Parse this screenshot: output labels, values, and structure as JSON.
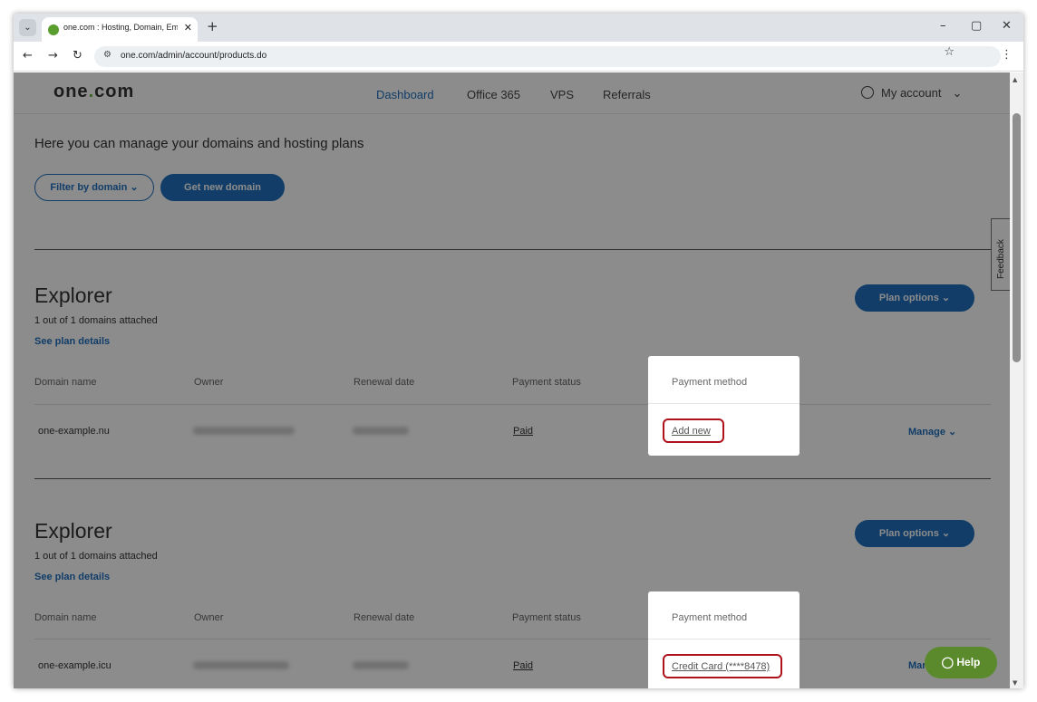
{
  "browser": {
    "tab_title": "one.com : Hosting, Domain, Email",
    "url": "one.com/admin/account/products.do",
    "new_tab": "+",
    "close_tab": "✕"
  },
  "header": {
    "logo_main": "one",
    "logo_dot": ".",
    "logo_tail": "com",
    "nav": [
      "Dashboard",
      "Office 365",
      "VPS",
      "Referrals"
    ],
    "account_label": "My account"
  },
  "intro": "Here you can manage your domains and hosting plans",
  "filter_button": "Filter by domain",
  "new_domain_button": "Get new domain",
  "feedback": "Feedback",
  "columns": {
    "domain": "Domain name",
    "owner": "Owner",
    "renewal": "Renewal date",
    "payment_status": "Payment status"
  },
  "plans": [
    {
      "title": "Explorer",
      "attached": "1 out of 1 domains attached",
      "details_link": "See plan details",
      "options_button": "Plan options",
      "domain": "one-example.nu",
      "payment_status": "Paid",
      "payment_method_header": "Payment method",
      "payment_method": "Add new",
      "manage": "Manage"
    },
    {
      "title": "Explorer",
      "attached": "1 out of 1 domains attached",
      "details_link": "See plan details",
      "options_button": "Plan options",
      "domain": "one-example.icu",
      "payment_status": "Paid",
      "payment_method_header": "Payment method",
      "payment_method": "Credit Card (****8478)",
      "manage": "Man"
    }
  ],
  "help_button": "Help",
  "colors": {
    "accent": "#1f6fbd",
    "brand_green": "#6db33f",
    "help_green": "#5b8a2d",
    "highlight": "#b0121b"
  }
}
